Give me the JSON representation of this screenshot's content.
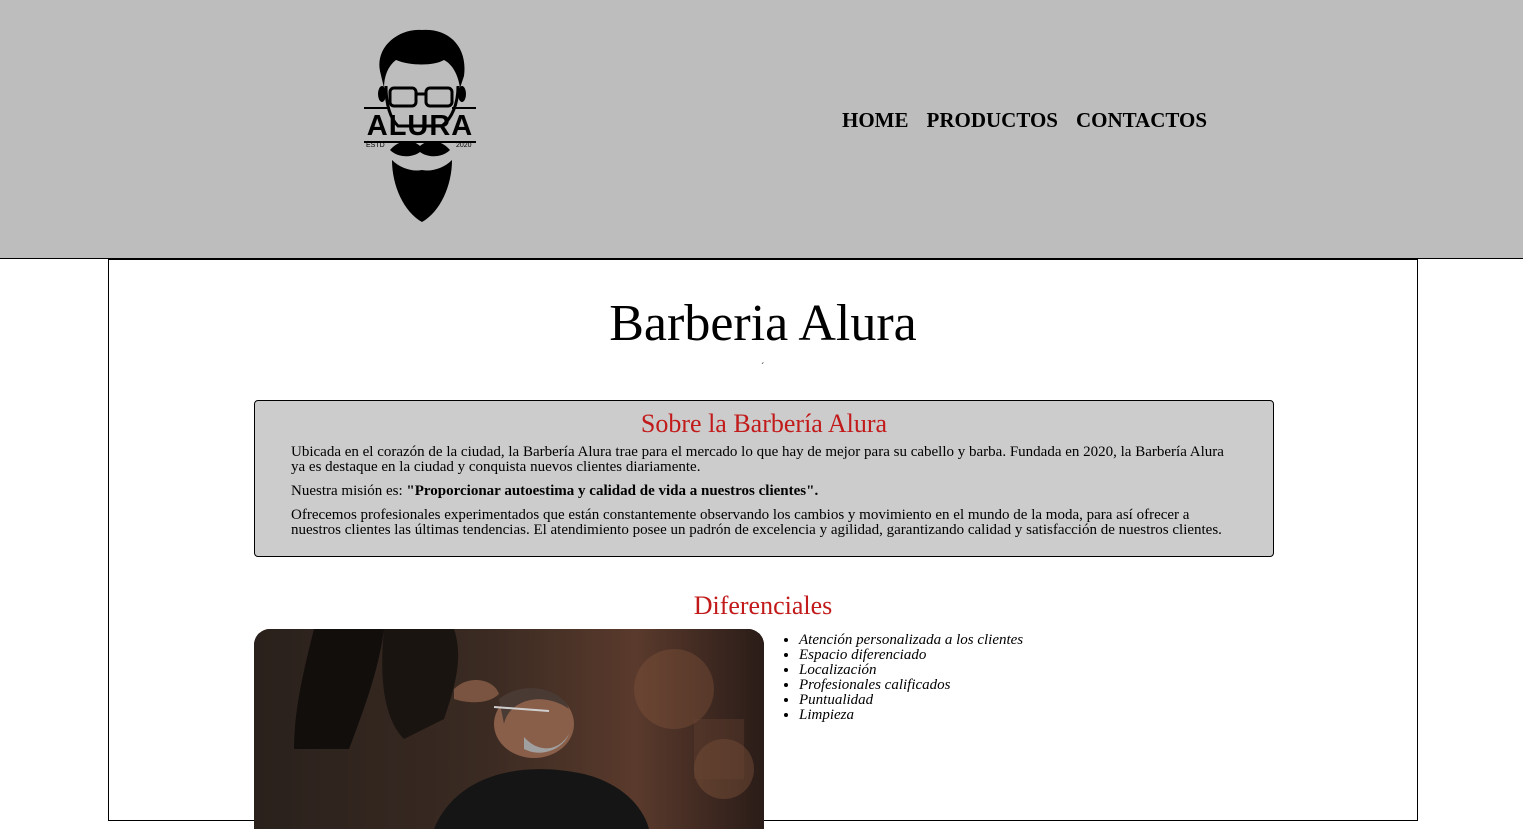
{
  "header": {
    "logo": {
      "text": "ALURA",
      "left_mark": "ESTD",
      "right_mark": "2020"
    },
    "nav": [
      "HOME",
      "PRODUCTOS",
      "CONTACTOS"
    ]
  },
  "main": {
    "title": "Barberia Alura",
    "about": {
      "heading": "Sobre la Barbería Alura",
      "p1": "Ubicada en el corazón de la ciudad, la Barbería Alura trae para el mercado lo que hay de mejor para su cabello y barba. Fundada en 2020, la Barbería Alura ya es destaque en la ciudad y conquista nuevos clientes diariamente.",
      "p2_prefix": "Nuestra misión es: ",
      "p2_strong": "\"Proporcionar autoestima y calidad de vida a nuestros clientes\".",
      "p3": "Ofrecemos profesionales experimentados que están constantemente observando los cambios y movimiento en el mundo de la moda, para así ofrecer a nuestros clientes las últimas tendencias. El atendimiento posee un padrón de excelencia y agilidad, garantizando calidad y satisfacción de nuestros clientes."
    },
    "diferenciales": {
      "heading": "Diferenciales",
      "items": [
        "Atención personalizada a los clientes",
        "Espacio diferenciado",
        "Localización",
        "Profesionales calificados",
        "Puntualidad",
        "Limpieza"
      ]
    }
  },
  "colors": {
    "header_bg": "#bdbdbd",
    "about_bg": "#cccccc",
    "accent_red": "#c21a1a"
  }
}
